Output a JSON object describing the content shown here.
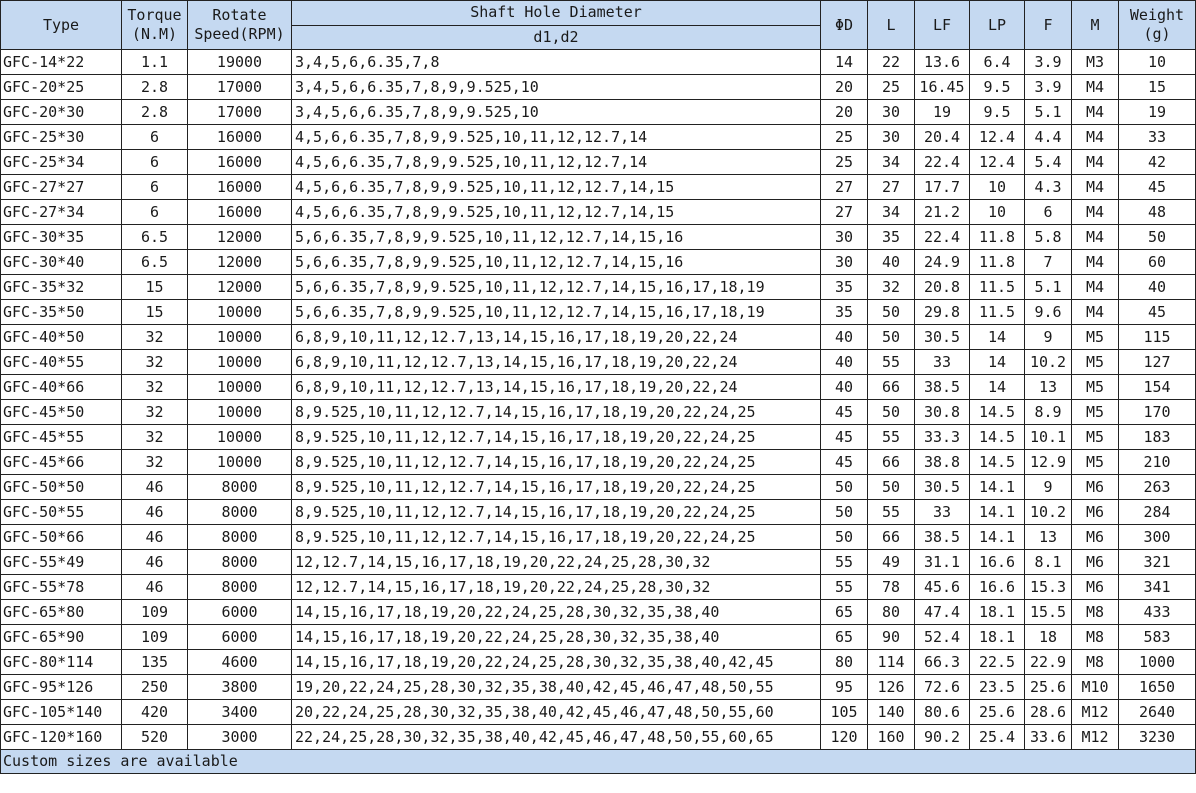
{
  "header": {
    "type": "Type",
    "torque_l1": "Torque",
    "torque_l2": "(N.M)",
    "speed_l1": "Rotate",
    "speed_l2": "Speed(RPM)",
    "shaft": "Shaft Hole Diameter",
    "shaft_sub": "d1,d2",
    "phid": "ΦD",
    "l": "L",
    "lf": "LF",
    "lp": "LP",
    "f": "F",
    "m": "M",
    "weight_l1": "Weight",
    "weight_l2": "(g)"
  },
  "rows": [
    [
      "GFC-14*22",
      "1.1",
      "19000",
      "3,4,5,6,6.35,7,8",
      "14",
      "22",
      "13.6",
      "6.4",
      "3.9",
      "M3",
      "10"
    ],
    [
      "GFC-20*25",
      "2.8",
      "17000",
      "3,4,5,6,6.35,7,8,9,9.525,10",
      "20",
      "25",
      "16.45",
      "9.5",
      "3.9",
      "M4",
      "15"
    ],
    [
      "GFC-20*30",
      "2.8",
      "17000",
      "3,4,5,6,6.35,7,8,9,9.525,10",
      "20",
      "30",
      "19",
      "9.5",
      "5.1",
      "M4",
      "19"
    ],
    [
      "GFC-25*30",
      "6",
      "16000",
      "4,5,6,6.35,7,8,9,9.525,10,11,12,12.7,14",
      "25",
      "30",
      "20.4",
      "12.4",
      "4.4",
      "M4",
      "33"
    ],
    [
      "GFC-25*34",
      "6",
      "16000",
      "4,5,6,6.35,7,8,9,9.525,10,11,12,12.7,14",
      "25",
      "34",
      "22.4",
      "12.4",
      "5.4",
      "M4",
      "42"
    ],
    [
      "GFC-27*27",
      "6",
      "16000",
      "4,5,6,6.35,7,8,9,9.525,10,11,12,12.7,14,15",
      "27",
      "27",
      "17.7",
      "10",
      "4.3",
      "M4",
      "45"
    ],
    [
      "GFC-27*34",
      "6",
      "16000",
      "4,5,6,6.35,7,8,9,9.525,10,11,12,12.7,14,15",
      "27",
      "34",
      "21.2",
      "10",
      "6",
      "M4",
      "48"
    ],
    [
      "GFC-30*35",
      "6.5",
      "12000",
      "5,6,6.35,7,8,9,9.525,10,11,12,12.7,14,15,16",
      "30",
      "35",
      "22.4",
      "11.8",
      "5.8",
      "M4",
      "50"
    ],
    [
      "GFC-30*40",
      "6.5",
      "12000",
      "5,6,6.35,7,8,9,9.525,10,11,12,12.7,14,15,16",
      "30",
      "40",
      "24.9",
      "11.8",
      "7",
      "M4",
      "60"
    ],
    [
      "GFC-35*32",
      "15",
      "12000",
      "5,6,6.35,7,8,9,9.525,10,11,12,12.7,14,15,16,17,18,19",
      "35",
      "32",
      "20.8",
      "11.5",
      "5.1",
      "M4",
      "40"
    ],
    [
      "GFC-35*50",
      "15",
      "10000",
      "5,6,6.35,7,8,9,9.525,10,11,12,12.7,14,15,16,17,18,19",
      "35",
      "50",
      "29.8",
      "11.5",
      "9.6",
      "M4",
      "45"
    ],
    [
      "GFC-40*50",
      "32",
      "10000",
      "6,8,9,10,11,12,12.7,13,14,15,16,17,18,19,20,22,24",
      "40",
      "50",
      "30.5",
      "14",
      "9",
      "M5",
      "115"
    ],
    [
      "GFC-40*55",
      "32",
      "10000",
      "6,8,9,10,11,12,12.7,13,14,15,16,17,18,19,20,22,24",
      "40",
      "55",
      "33",
      "14",
      "10.2",
      "M5",
      "127"
    ],
    [
      "GFC-40*66",
      "32",
      "10000",
      "6,8,9,10,11,12,12.7,13,14,15,16,17,18,19,20,22,24",
      "40",
      "66",
      "38.5",
      "14",
      "13",
      "M5",
      "154"
    ],
    [
      "GFC-45*50",
      "32",
      "10000",
      "8,9.525,10,11,12,12.7,14,15,16,17,18,19,20,22,24,25",
      "45",
      "50",
      "30.8",
      "14.5",
      "8.9",
      "M5",
      "170"
    ],
    [
      "GFC-45*55",
      "32",
      "10000",
      "8,9.525,10,11,12,12.7,14,15,16,17,18,19,20,22,24,25",
      "45",
      "55",
      "33.3",
      "14.5",
      "10.1",
      "M5",
      "183"
    ],
    [
      "GFC-45*66",
      "32",
      "10000",
      "8,9.525,10,11,12,12.7,14,15,16,17,18,19,20,22,24,25",
      "45",
      "66",
      "38.8",
      "14.5",
      "12.9",
      "M5",
      "210"
    ],
    [
      "GFC-50*50",
      "46",
      "8000",
      "8,9.525,10,11,12,12.7,14,15,16,17,18,19,20,22,24,25",
      "50",
      "50",
      "30.5",
      "14.1",
      "9",
      "M6",
      "263"
    ],
    [
      "GFC-50*55",
      "46",
      "8000",
      "8,9.525,10,11,12,12.7,14,15,16,17,18,19,20,22,24,25",
      "50",
      "55",
      "33",
      "14.1",
      "10.2",
      "M6",
      "284"
    ],
    [
      "GFC-50*66",
      "46",
      "8000",
      "8,9.525,10,11,12,12.7,14,15,16,17,18,19,20,22,24,25",
      "50",
      "66",
      "38.5",
      "14.1",
      "13",
      "M6",
      "300"
    ],
    [
      "GFC-55*49",
      "46",
      "8000",
      "12,12.7,14,15,16,17,18,19,20,22,24,25,28,30,32",
      "55",
      "49",
      "31.1",
      "16.6",
      "8.1",
      "M6",
      "321"
    ],
    [
      "GFC-55*78",
      "46",
      "8000",
      "12,12.7,14,15,16,17,18,19,20,22,24,25,28,30,32",
      "55",
      "78",
      "45.6",
      "16.6",
      "15.3",
      "M6",
      "341"
    ],
    [
      "GFC-65*80",
      "109",
      "6000",
      "14,15,16,17,18,19,20,22,24,25,28,30,32,35,38,40",
      "65",
      "80",
      "47.4",
      "18.1",
      "15.5",
      "M8",
      "433"
    ],
    [
      "GFC-65*90",
      "109",
      "6000",
      "14,15,16,17,18,19,20,22,24,25,28,30,32,35,38,40",
      "65",
      "90",
      "52.4",
      "18.1",
      "18",
      "M8",
      "583"
    ],
    [
      "GFC-80*114",
      "135",
      "4600",
      "14,15,16,17,18,19,20,22,24,25,28,30,32,35,38,40,42,45",
      "80",
      "114",
      "66.3",
      "22.5",
      "22.9",
      "M8",
      "1000"
    ],
    [
      "GFC-95*126",
      "250",
      "3800",
      "19,20,22,24,25,28,30,32,35,38,40,42,45,46,47,48,50,55",
      "95",
      "126",
      "72.6",
      "23.5",
      "25.6",
      "M10",
      "1650"
    ],
    [
      "GFC-105*140",
      "420",
      "3400",
      "20,22,24,25,28,30,32,35,38,40,42,45,46,47,48,50,55,60",
      "105",
      "140",
      "80.6",
      "25.6",
      "28.6",
      "M12",
      "2640"
    ],
    [
      "GFC-120*160",
      "520",
      "3000",
      "22,24,25,28,30,32,35,38,40,42,45,46,47,48,50,55,60,65",
      "120",
      "160",
      "90.2",
      "25.4",
      "33.6",
      "M12",
      "3230"
    ]
  ],
  "footer": "Custom sizes are available",
  "colors": {
    "header_bg": "#c5d9f1",
    "border": "#222222",
    "text": "#1a1a1a"
  }
}
